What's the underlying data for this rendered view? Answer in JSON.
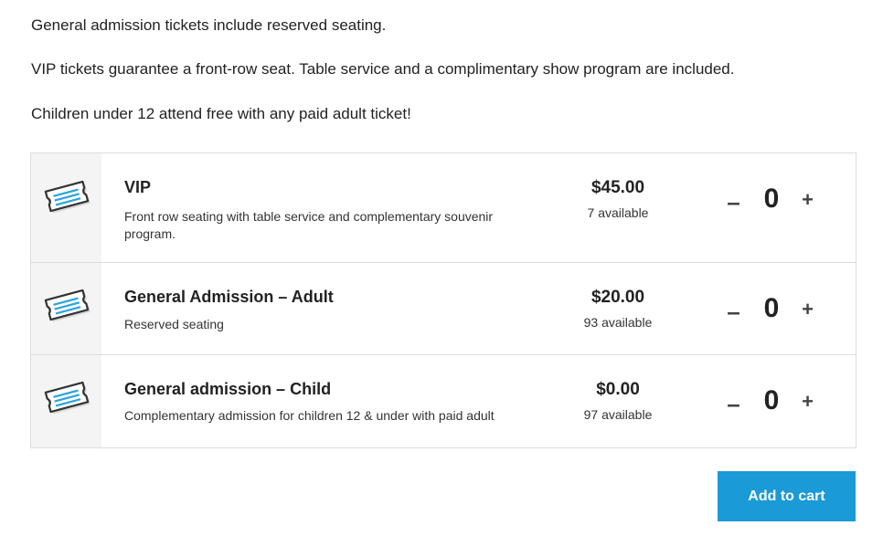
{
  "intro": {
    "p1": "General admission tickets include reserved seating.",
    "p2": "VIP tickets guarantee a front-row seat. Table service and a complimentary show program are included.",
    "p3": "Children under 12 attend free with any paid adult ticket!"
  },
  "tickets": [
    {
      "icon": "ticket-icon",
      "name": "VIP",
      "description": "Front row seating with table service and complementary souvenir program.",
      "price": "$45.00",
      "available": "7 available",
      "quantity": "0"
    },
    {
      "icon": "ticket-icon",
      "name": "General Admission – Adult",
      "description": "Reserved seating",
      "price": "$20.00",
      "available": "93 available",
      "quantity": "0"
    },
    {
      "icon": "ticket-icon",
      "name": "General admission – Child",
      "description": "Complementary admission for children 12 & under with paid adult",
      "price": "$0.00",
      "available": "97 available",
      "quantity": "0"
    }
  ],
  "controls": {
    "minus_label": "–",
    "plus_label": "+"
  },
  "cart": {
    "add_label": "Add to cart"
  },
  "colors": {
    "accent": "#1a9ad6",
    "icon_stripe": "#2aa3dd"
  }
}
